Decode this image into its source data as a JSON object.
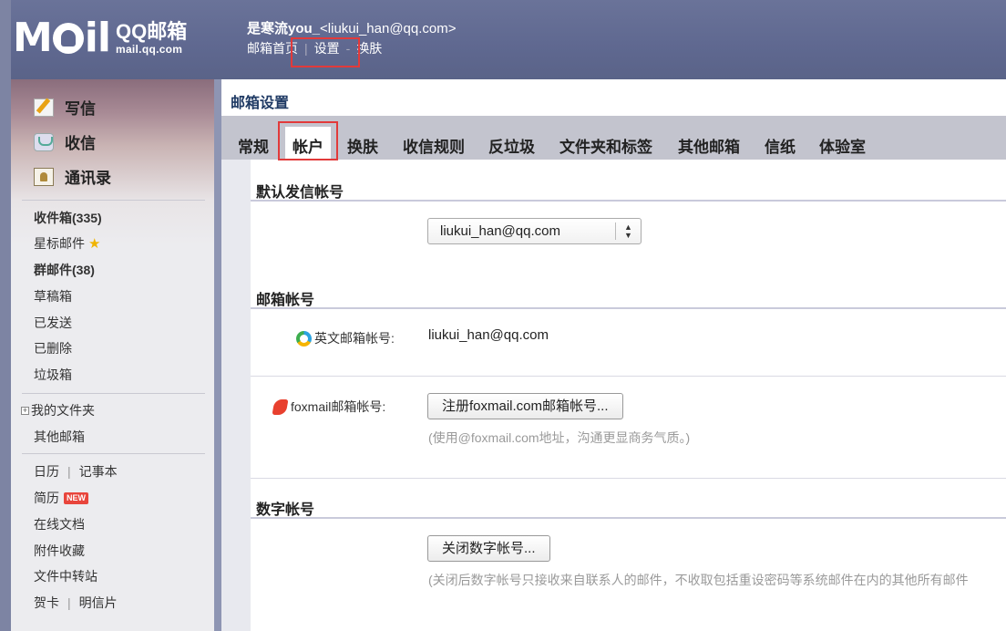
{
  "header": {
    "logo_main": "MⓄil",
    "logo_qq": "QQ邮箱",
    "logo_url": "mail.qq.com",
    "user_name": "是寒流you_",
    "user_email": "<liukui_han@qq.com>",
    "links": [
      "邮箱首页",
      "设置",
      "换肤"
    ]
  },
  "sidebar": {
    "compose": "写信",
    "receive": "收信",
    "contacts": "通讯录",
    "folders": [
      {
        "label": "收件箱(335)",
        "bold": true
      },
      {
        "label": "星标邮件",
        "bold": false
      },
      {
        "label": "群邮件(38)",
        "bold": true
      },
      {
        "label": "草稿箱",
        "bold": false
      },
      {
        "label": "已发送",
        "bold": false
      },
      {
        "label": "已删除",
        "bold": false
      },
      {
        "label": "垃圾箱",
        "bold": false
      }
    ],
    "my_folders": "我的文件夹",
    "other_mail": "其他邮箱",
    "calendar": "日历",
    "notes": "记事本",
    "resume": "简历",
    "new_badge": "NEW",
    "docs": "在线文档",
    "attachments": "附件收藏",
    "transfer": "文件中转站",
    "greeting_card": "贺卡",
    "postcard": "明信片"
  },
  "main": {
    "title": "邮箱设置",
    "tabs": [
      "常规",
      "帐户",
      "换肤",
      "收信规则",
      "反垃圾",
      "文件夹和标签",
      "其他邮箱",
      "信纸",
      "体验室"
    ],
    "active_tab": "帐户",
    "default_sender": {
      "title": "默认发信帐号",
      "selected": "liukui_han@qq.com"
    },
    "mail_account": {
      "title": "邮箱帐号",
      "english_label": "英文邮箱帐号:",
      "english_value": "liukui_han@qq.com",
      "foxmail_label": "foxmail邮箱帐号:",
      "foxmail_button": "注册foxmail.com邮箱帐号...",
      "foxmail_hint": "(使用@foxmail.com地址，沟通更显商务气质。)"
    },
    "digital_account": {
      "title": "数字帐号",
      "button": "关闭数字帐号...",
      "hint": "(关闭后数字帐号只接收来自联系人的邮件，不收取包括重设密码等系统邮件在内的其他所有邮件"
    }
  }
}
